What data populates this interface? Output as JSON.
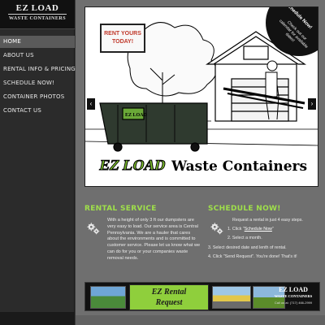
{
  "logo": {
    "line1": "EZ LOAD",
    "line2": "WASTE CONTAINERS"
  },
  "nav": {
    "items": [
      {
        "label": "Home",
        "active": true
      },
      {
        "label": "About Us"
      },
      {
        "label": "Rental Info & Pricing"
      },
      {
        "label": "Schedule Now!"
      },
      {
        "label": "Container Photos"
      },
      {
        "label": "Contact Us"
      }
    ]
  },
  "slider": {
    "promo_line1": "RENT YOURS",
    "promo_line2": "TODAY!",
    "ribbon_title": "Schedule Now!",
    "ribbon_sub": "Check out our calendar for available dates!",
    "container_label": "EZ LOAD",
    "banner_ez": "EZ LOAD",
    "banner_wc": "Waste Containers",
    "prev_icon": "‹",
    "next_icon": "›"
  },
  "rental": {
    "title": "Rental Service",
    "body": "With a height of only 3 ft our dumpsters are very easy to load. Our service area is Central Pennsylvania. We are a hauler that cares about the environments and is committed to customer service. Please let us know what we can do for you or your companies waste removal needs."
  },
  "schedule": {
    "title": "Schedule Now!",
    "intro": "Request a rental in just 4 easy steps.",
    "step1_prefix": "1. Click \"",
    "step1_link": "Schedule Now",
    "step1_suffix": "\"",
    "step2": "2. Select a month.",
    "step3": "3. Select desired date and lenth of rental.",
    "step4": "4. Click \"Send Request\". You're done! That's it!"
  },
  "ad": {
    "line1": "EZ Rental",
    "line2": "Request",
    "logo_line1": "EZ LOAD",
    "logo_line2": "WASTE CONTAINERS",
    "phone": "Call us at: (717) 466-2999"
  },
  "colors": {
    "accent": "#9fe04a",
    "sidebar": "#2b2b2b",
    "content": "#6f6f6f"
  }
}
